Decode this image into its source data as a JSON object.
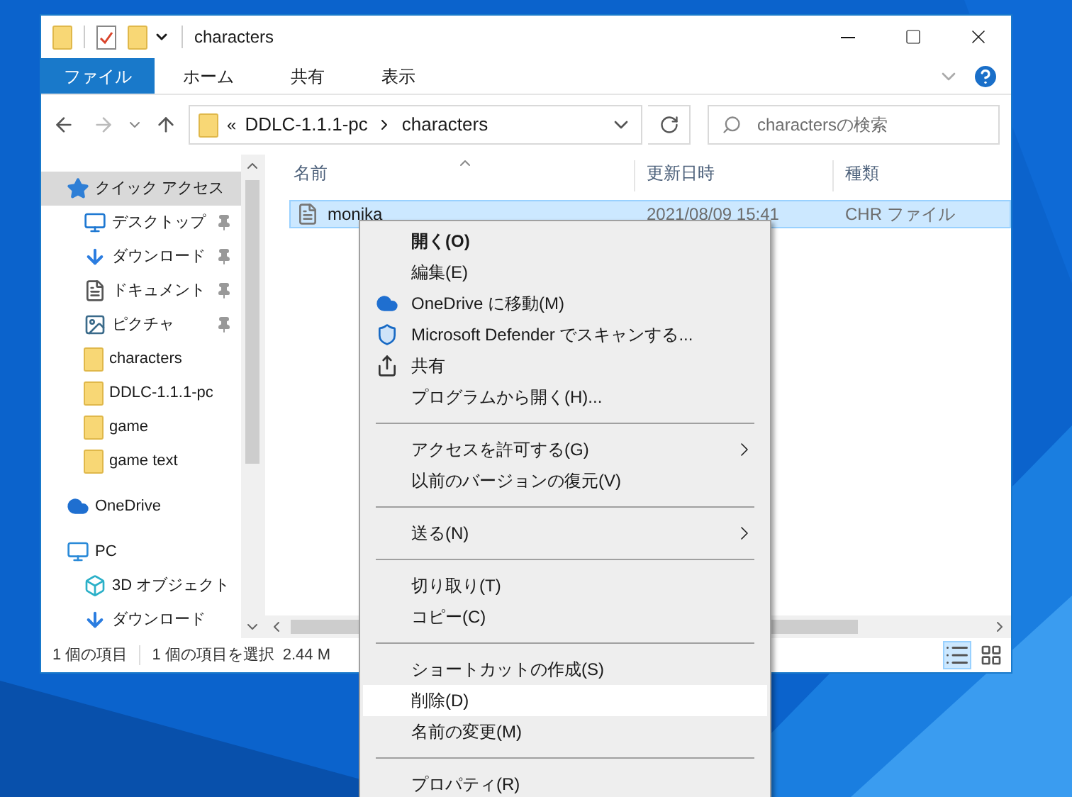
{
  "window": {
    "title": "characters"
  },
  "ribbon": {
    "tabs": [
      {
        "label": "ファイル",
        "selected": true
      },
      {
        "label": "ホーム",
        "selected": false
      },
      {
        "label": "共有",
        "selected": false
      },
      {
        "label": "表示",
        "selected": false
      }
    ]
  },
  "address": {
    "overflow": "«",
    "path": [
      "DDLC-1.1.1-pc",
      "characters"
    ],
    "search": {
      "placeholder": "charactersの検索"
    }
  },
  "sidebar": {
    "items": [
      {
        "label": "クイック アクセス",
        "kind": "star",
        "selected": true,
        "children": [
          {
            "label": "デスクトップ",
            "kind": "desktop",
            "pinned": true,
            "selected": false
          },
          {
            "label": "ダウンロード",
            "kind": "download",
            "pinned": true,
            "selected": false
          },
          {
            "label": "ドキュメント",
            "kind": "document",
            "pinned": true,
            "selected": false
          },
          {
            "label": "ピクチャ",
            "kind": "pictures",
            "pinned": true,
            "selected": false
          },
          {
            "label": "characters",
            "kind": "folder",
            "pinned": false,
            "selected": false
          },
          {
            "label": "DDLC-1.1.1-pc",
            "kind": "folder",
            "pinned": false,
            "selected": false
          },
          {
            "label": "game",
            "kind": "folder",
            "pinned": false,
            "selected": false
          },
          {
            "label": "game text",
            "kind": "folder",
            "pinned": false,
            "selected": false
          }
        ]
      },
      {
        "label": "OneDrive",
        "kind": "cloud",
        "selected": false
      },
      {
        "label": "PC",
        "kind": "pc",
        "selected": false,
        "children": [
          {
            "label": "3D オブジェクト",
            "kind": "cube",
            "pinned": false,
            "selected": false
          },
          {
            "label": "ダウンロード",
            "kind": "download",
            "pinned": false,
            "selected": false
          }
        ]
      }
    ]
  },
  "table": {
    "columns": [
      "名前",
      "更新日時",
      "種類"
    ],
    "rows": [
      {
        "name": "monika",
        "modified": "2021/08/09 15:41",
        "type": "CHR ファイル",
        "selected": true
      }
    ]
  },
  "status_bar": {
    "count": "1 個の項目",
    "selection": "1 個の項目を選択",
    "size": "2.44 M"
  },
  "context_menu": {
    "items": [
      {
        "kind": "item",
        "label": "開く(O)",
        "default": true,
        "selected": false
      },
      {
        "kind": "item",
        "label": "編集(E)",
        "selected": false
      },
      {
        "kind": "cloud",
        "label": "OneDrive に移動(M)",
        "selected": false
      },
      {
        "kind": "shield",
        "label": "Microsoft Defender でスキャンする...",
        "selected": false
      },
      {
        "kind": "share",
        "label": "共有",
        "selected": false
      },
      {
        "kind": "item",
        "label": "プログラムから開く(H)...",
        "selected": false
      },
      {
        "kind": "separator"
      },
      {
        "kind": "item",
        "label": "アクセスを許可する(G)",
        "submenu": true,
        "selected": false
      },
      {
        "kind": "item",
        "label": "以前のバージョンの復元(V)",
        "selected": false
      },
      {
        "kind": "separator"
      },
      {
        "kind": "item",
        "label": "送る(N)",
        "submenu": true,
        "selected": false
      },
      {
        "kind": "separator"
      },
      {
        "kind": "item",
        "label": "切り取り(T)",
        "selected": false
      },
      {
        "kind": "item",
        "label": "コピー(C)",
        "selected": false
      },
      {
        "kind": "separator"
      },
      {
        "kind": "item",
        "label": "ショートカットの作成(S)",
        "selected": false
      },
      {
        "kind": "item",
        "label": "削除(D)",
        "selected": true
      },
      {
        "kind": "item",
        "label": "名前の変更(M)",
        "selected": false
      },
      {
        "kind": "separator"
      },
      {
        "kind": "item",
        "label": "プロパティ(R)",
        "selected": false
      }
    ]
  }
}
